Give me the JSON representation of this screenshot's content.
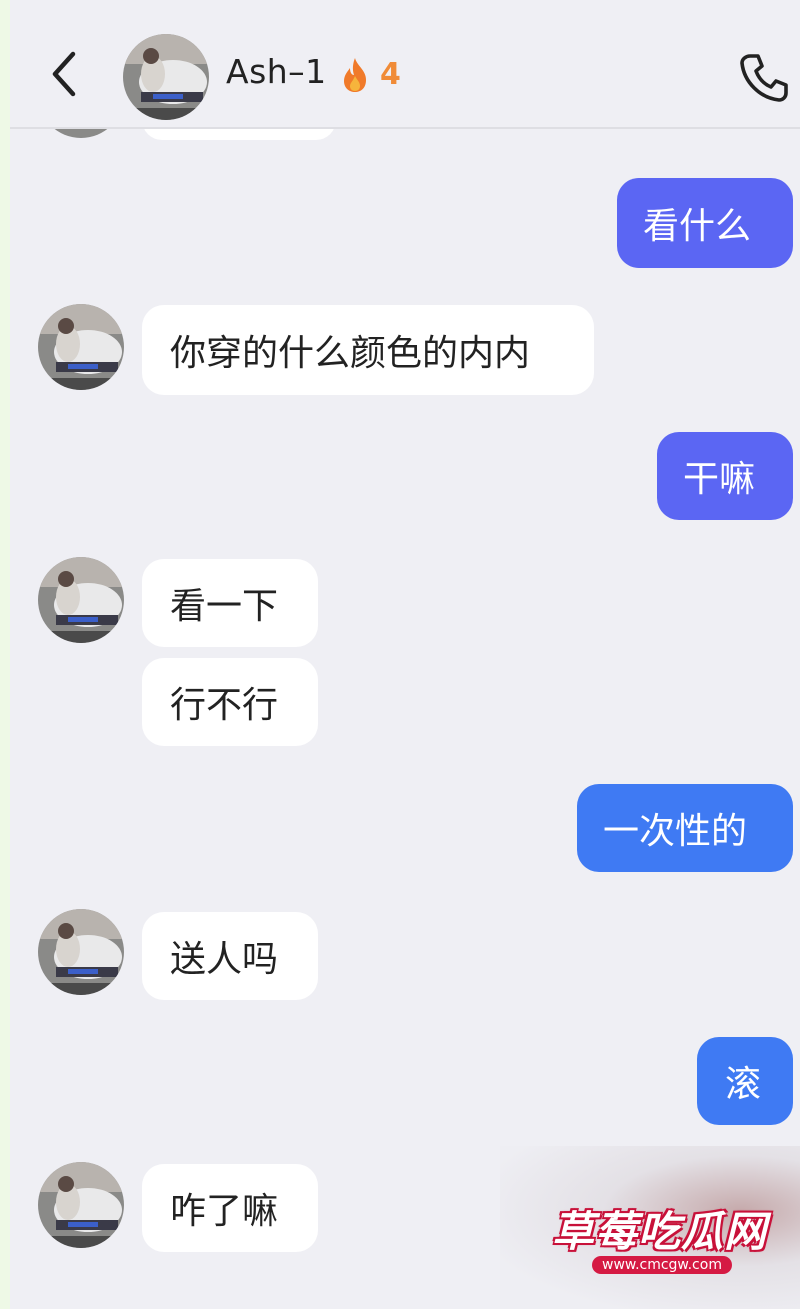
{
  "header": {
    "contact_name": "Ash–1",
    "streak_count": "4",
    "back_icon": "chevron-left-icon",
    "streak_icon": "fire-icon",
    "call_icon": "phone-icon"
  },
  "messages": [
    {
      "side": "out",
      "text": "看什么"
    },
    {
      "side": "in",
      "text": "你穿的什么颜色的内内"
    },
    {
      "side": "out",
      "text": "干嘛"
    },
    {
      "side": "in",
      "text": "看一下"
    },
    {
      "side": "in",
      "text": "行不行"
    },
    {
      "side": "out",
      "text": "一次性的"
    },
    {
      "side": "in",
      "text": "送人吗"
    },
    {
      "side": "out",
      "text": "滚"
    },
    {
      "side": "in",
      "text": "咋了嘛"
    }
  ],
  "watermark": {
    "title": "草莓吃瓜网",
    "url": "www.cmcgw.com"
  },
  "colors": {
    "background": "#efeff4",
    "incoming_bubble": "#ffffff",
    "outgoing_bubble": "#5b66f3",
    "outgoing_bubble_alt": "#3f7af3",
    "streak": "#f08b37"
  }
}
